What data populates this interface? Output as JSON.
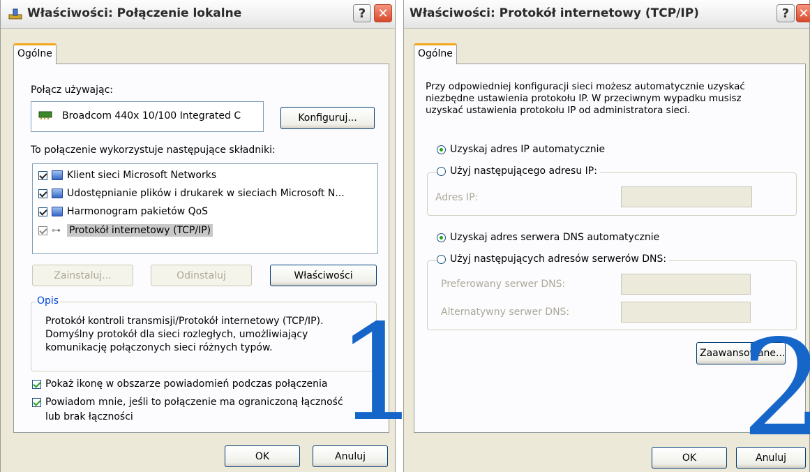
{
  "dialog1": {
    "title": "Właściwości: Połączenie lokalne",
    "help": "?",
    "close": "✕",
    "tab": "Ogólne",
    "connect_using_label": "Połącz używając:",
    "adapter_name": "Broadcom 440x 10/100 Integrated C",
    "configure_button": "Konfiguruj...",
    "components_label": "To połączenie wykorzystuje następujące składniki:",
    "components": [
      {
        "label": "Klient sieci Microsoft Networks",
        "checked": true
      },
      {
        "label": "Udostępnianie plików i drukarek w sieciach Microsoft N...",
        "checked": true
      },
      {
        "label": "Harmonogram pakietów QoS",
        "checked": true
      },
      {
        "label": "Protokół internetowy (TCP/IP)",
        "checked": true,
        "selected": true
      }
    ],
    "install_button": "Zainstaluj...",
    "uninstall_button": "Odinstaluj",
    "properties_button": "Właściwości",
    "description_legend": "Opis",
    "description_text": "Protokół kontroli transmisji/Protokół internetowy (TCP/IP). Domyślny protokół dla sieci rozległych, umożliwiający komunikację połączonych sieci różnych typów.",
    "show_icon_label": "Pokaż ikonę w obszarze powiadomień podczas połączenia",
    "notify_label_1": "Powiadom mnie, jeśli to połączenie ma ograniczoną łączność",
    "notify_label_2": "lub brak łączności",
    "ok_button": "OK",
    "cancel_button": "Anuluj",
    "overlay_number": "1"
  },
  "dialog2": {
    "title": "Właściwości: Protokół internetowy (TCP/IP)",
    "help": "?",
    "close": "✕",
    "tab": "Ogólne",
    "intro_text": "Przy odpowiedniej konfiguracji sieci możesz automatycznie uzyskać niezbędne ustawienia protokołu IP. W przeciwnym wypadku musisz uzyskać ustawienia protokołu IP od administratora sieci.",
    "auto_ip_label": "Uzyskaj adres IP automatycznie",
    "manual_ip_label": "Użyj następującego adresu IP:",
    "ip_address_label": "Adres IP:",
    "auto_dns_label": "Uzyskaj adres serwera DNS automatycznie",
    "manual_dns_label": "Użyj następujących adresów serwerów DNS:",
    "preferred_dns_label": "Preferowany serwer DNS:",
    "alternate_dns_label": "Alternatywny serwer DNS:",
    "advanced_button": "Zaawansowane...",
    "ok_button": "OK",
    "cancel_button": "Anuluj",
    "overlay_number": "2"
  },
  "colors": {
    "dialog_bg": "#ece9d8",
    "panel_bg": "#fcfcfe",
    "overlay_number": "#1566c8",
    "tab_accent": "#f3a51a"
  }
}
